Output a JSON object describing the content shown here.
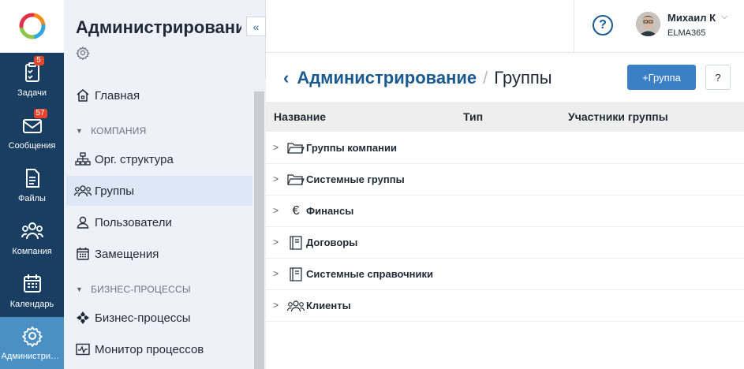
{
  "rail": {
    "items": [
      {
        "label": "Задачи",
        "badge": "5",
        "icon": "tasks-icon"
      },
      {
        "label": "Сообщения",
        "badge": "57",
        "icon": "messages-icon"
      },
      {
        "label": "Файлы",
        "badge": null,
        "icon": "files-icon"
      },
      {
        "label": "Компания",
        "badge": null,
        "icon": "company-icon"
      },
      {
        "label": "Календарь",
        "badge": null,
        "icon": "calendar-icon"
      },
      {
        "label": "Администрирование",
        "badge": null,
        "icon": "gear-icon",
        "active": true
      }
    ]
  },
  "sidebar": {
    "title": "Администрирование",
    "collapse_glyph": "«",
    "items": [
      {
        "label": "Главная",
        "icon": "home-icon"
      },
      {
        "label": "Орг. структура",
        "icon": "org-structure-icon"
      },
      {
        "label": "Группы",
        "icon": "groups-icon",
        "active": true
      },
      {
        "label": "Пользователи",
        "icon": "user-icon"
      },
      {
        "label": "Замещения",
        "icon": "substitutions-icon"
      },
      {
        "label": "Бизнес-процессы",
        "icon": "business-process-icon"
      },
      {
        "label": "Монитор процессов",
        "icon": "process-monitor-icon"
      }
    ],
    "sections": [
      "КОМПАНИЯ",
      "БИЗНЕС-ПРОЦЕССЫ"
    ]
  },
  "header": {
    "help_glyph": "?",
    "user": {
      "name": "Михаил К",
      "org": "ELMA365"
    }
  },
  "page": {
    "breadcrumb_parent": "Администрирование",
    "breadcrumb_separator": "/",
    "breadcrumb_current": "Группы",
    "add_button_label": "+Группа",
    "help_button_glyph": "?"
  },
  "table": {
    "columns": [
      "Название",
      "Тип",
      "Участники группы"
    ],
    "rows": [
      {
        "label": "Группы компании",
        "icon": "folder-icon"
      },
      {
        "label": "Системные группы",
        "icon": "folder-icon"
      },
      {
        "label": "Финансы",
        "icon": "euro-icon"
      },
      {
        "label": "Договоры",
        "icon": "book-icon"
      },
      {
        "label": "Системные справочники",
        "icon": "book-icon"
      },
      {
        "label": "Клиенты",
        "icon": "people-icon"
      }
    ]
  },
  "colors": {
    "rail_bg": "#1a3e61",
    "rail_active": "#4a90c4",
    "accent": "#3b7fc4",
    "link": "#1a5a8f",
    "badge": "#e8432e"
  }
}
